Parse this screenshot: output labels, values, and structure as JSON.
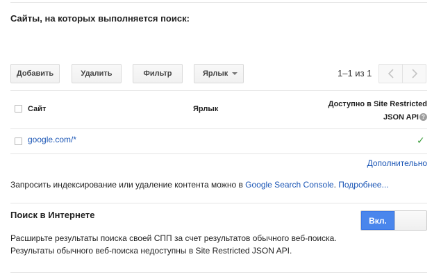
{
  "sites_section": {
    "title": "Сайты, на которых выполняется поиск:"
  },
  "toolbar": {
    "add_label": "Добавить",
    "delete_label": "Удалить",
    "filter_label": "Фильтр",
    "label_dropdown": "Ярлык",
    "pager_text": "1–1 из 1"
  },
  "table": {
    "headers": {
      "site": "Сайт",
      "label": "Ярлык",
      "availability_line1": "Доступно в Site Restricted",
      "availability_line2": "JSON API"
    },
    "rows": [
      {
        "site": "google.com/*",
        "label": "",
        "available": "✓"
      }
    ],
    "more_link": "Дополнительно"
  },
  "indexing": {
    "text": "Запросить индексирование или удаление контента можно в ",
    "console_link": "Google Search Console",
    "separator": ". ",
    "more_link": "Подробнее..."
  },
  "web_search": {
    "title": "Поиск в Интернете",
    "description_line1": "Расширьте результаты поиска своей СПП за счет результатов обычного веб-поиска.",
    "description_line2": "Результаты обычного веб-поиска недоступны в Site Restricted JSON API.",
    "toggle_label": "Вкл.",
    "toggle_state": "on"
  },
  "colors": {
    "link": "#1a55b5",
    "toggle_on": "#4a86ec",
    "check": "#3c9e3c"
  },
  "icons": {
    "help": "help-icon",
    "prev": "chevron-left-icon",
    "next": "chevron-right-icon",
    "dropdown": "caret-down-icon",
    "check": "check-icon"
  }
}
